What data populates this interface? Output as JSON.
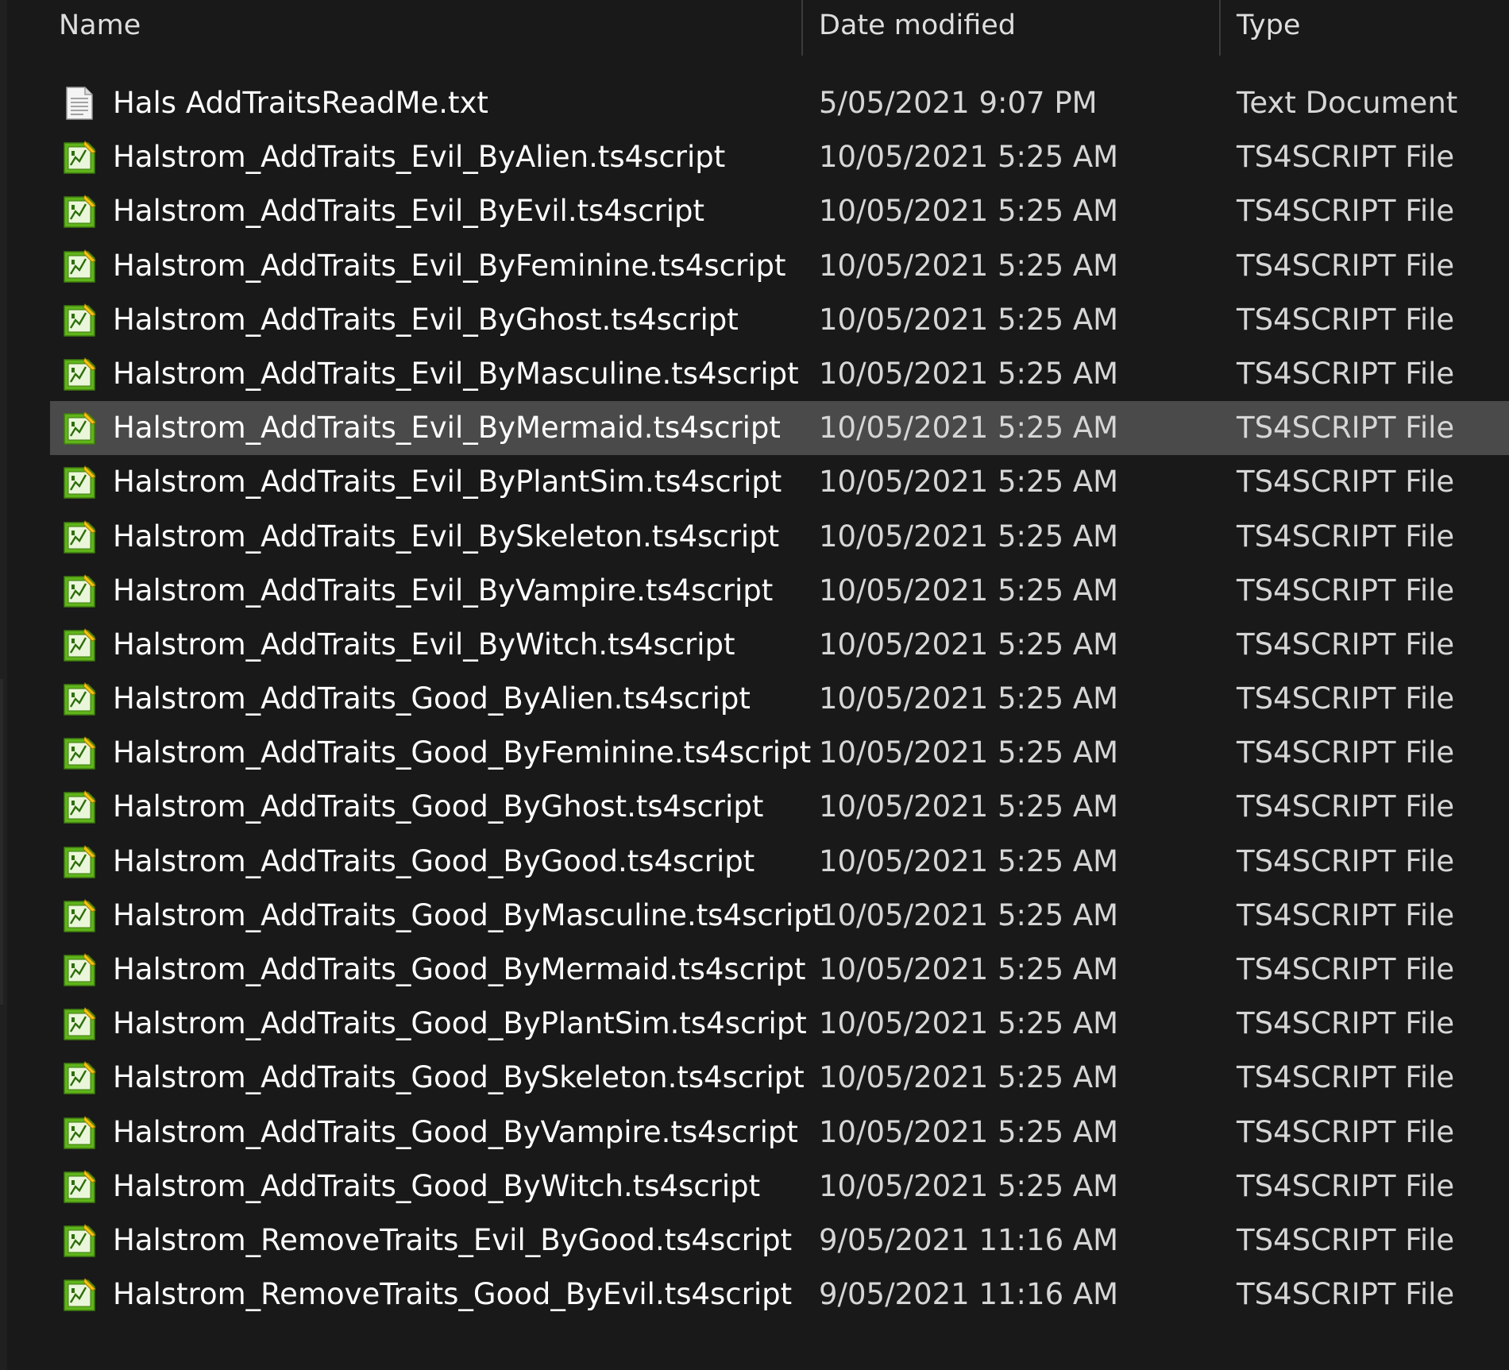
{
  "columns": {
    "name": "Name",
    "date_modified": "Date modified",
    "type": "Type"
  },
  "files": [
    {
      "name": "Hals AddTraitsReadMe.txt",
      "date": "5/05/2021 9:07 PM",
      "type": "Text Document",
      "icon": "text-document-icon",
      "selected": false
    },
    {
      "name": "Halstrom_AddTraits_Evil_ByAlien.ts4script",
      "date": "10/05/2021 5:25 AM",
      "type": "TS4SCRIPT File",
      "icon": "ts4script-file-icon",
      "selected": false
    },
    {
      "name": "Halstrom_AddTraits_Evil_ByEvil.ts4script",
      "date": "10/05/2021 5:25 AM",
      "type": "TS4SCRIPT File",
      "icon": "ts4script-file-icon",
      "selected": false
    },
    {
      "name": "Halstrom_AddTraits_Evil_ByFeminine.ts4script",
      "date": "10/05/2021 5:25 AM",
      "type": "TS4SCRIPT File",
      "icon": "ts4script-file-icon",
      "selected": false
    },
    {
      "name": "Halstrom_AddTraits_Evil_ByGhost.ts4script",
      "date": "10/05/2021 5:25 AM",
      "type": "TS4SCRIPT File",
      "icon": "ts4script-file-icon",
      "selected": false
    },
    {
      "name": "Halstrom_AddTraits_Evil_ByMasculine.ts4script",
      "date": "10/05/2021 5:25 AM",
      "type": "TS4SCRIPT File",
      "icon": "ts4script-file-icon",
      "selected": false
    },
    {
      "name": "Halstrom_AddTraits_Evil_ByMermaid.ts4script",
      "date": "10/05/2021 5:25 AM",
      "type": "TS4SCRIPT File",
      "icon": "ts4script-file-icon",
      "selected": true
    },
    {
      "name": "Halstrom_AddTraits_Evil_ByPlantSim.ts4script",
      "date": "10/05/2021 5:25 AM",
      "type": "TS4SCRIPT File",
      "icon": "ts4script-file-icon",
      "selected": false
    },
    {
      "name": "Halstrom_AddTraits_Evil_BySkeleton.ts4script",
      "date": "10/05/2021 5:25 AM",
      "type": "TS4SCRIPT File",
      "icon": "ts4script-file-icon",
      "selected": false
    },
    {
      "name": "Halstrom_AddTraits_Evil_ByVampire.ts4script",
      "date": "10/05/2021 5:25 AM",
      "type": "TS4SCRIPT File",
      "icon": "ts4script-file-icon",
      "selected": false
    },
    {
      "name": "Halstrom_AddTraits_Evil_ByWitch.ts4script",
      "date": "10/05/2021 5:25 AM",
      "type": "TS4SCRIPT File",
      "icon": "ts4script-file-icon",
      "selected": false
    },
    {
      "name": "Halstrom_AddTraits_Good_ByAlien.ts4script",
      "date": "10/05/2021 5:25 AM",
      "type": "TS4SCRIPT File",
      "icon": "ts4script-file-icon",
      "selected": false
    },
    {
      "name": "Halstrom_AddTraits_Good_ByFeminine.ts4script",
      "date": "10/05/2021 5:25 AM",
      "type": "TS4SCRIPT File",
      "icon": "ts4script-file-icon",
      "selected": false
    },
    {
      "name": "Halstrom_AddTraits_Good_ByGhost.ts4script",
      "date": "10/05/2021 5:25 AM",
      "type": "TS4SCRIPT File",
      "icon": "ts4script-file-icon",
      "selected": false
    },
    {
      "name": "Halstrom_AddTraits_Good_ByGood.ts4script",
      "date": "10/05/2021 5:25 AM",
      "type": "TS4SCRIPT File",
      "icon": "ts4script-file-icon",
      "selected": false
    },
    {
      "name": "Halstrom_AddTraits_Good_ByMasculine.ts4script",
      "date": "10/05/2021 5:25 AM",
      "type": "TS4SCRIPT File",
      "icon": "ts4script-file-icon",
      "selected": false
    },
    {
      "name": "Halstrom_AddTraits_Good_ByMermaid.ts4script",
      "date": "10/05/2021 5:25 AM",
      "type": "TS4SCRIPT File",
      "icon": "ts4script-file-icon",
      "selected": false
    },
    {
      "name": "Halstrom_AddTraits_Good_ByPlantSim.ts4script",
      "date": "10/05/2021 5:25 AM",
      "type": "TS4SCRIPT File",
      "icon": "ts4script-file-icon",
      "selected": false
    },
    {
      "name": "Halstrom_AddTraits_Good_BySkeleton.ts4script",
      "date": "10/05/2021 5:25 AM",
      "type": "TS4SCRIPT File",
      "icon": "ts4script-file-icon",
      "selected": false
    },
    {
      "name": "Halstrom_AddTraits_Good_ByVampire.ts4script",
      "date": "10/05/2021 5:25 AM",
      "type": "TS4SCRIPT File",
      "icon": "ts4script-file-icon",
      "selected": false
    },
    {
      "name": "Halstrom_AddTraits_Good_ByWitch.ts4script",
      "date": "10/05/2021 5:25 AM",
      "type": "TS4SCRIPT File",
      "icon": "ts4script-file-icon",
      "selected": false
    },
    {
      "name": "Halstrom_RemoveTraits_Evil_ByGood.ts4script",
      "date": "9/05/2021 11:16 AM",
      "type": "TS4SCRIPT File",
      "icon": "ts4script-file-icon",
      "selected": false
    },
    {
      "name": "Halstrom_RemoveTraits_Good_ByEvil.ts4script",
      "date": "9/05/2021 11:16 AM",
      "type": "TS4SCRIPT File",
      "icon": "ts4script-file-icon",
      "selected": false
    }
  ],
  "colors": {
    "background": "#191919",
    "selected_row": "#4a4a4a",
    "script_icon_green": "#5fb41a",
    "text_primary": "#ffffff",
    "text_secondary": "#d6d6d6"
  }
}
